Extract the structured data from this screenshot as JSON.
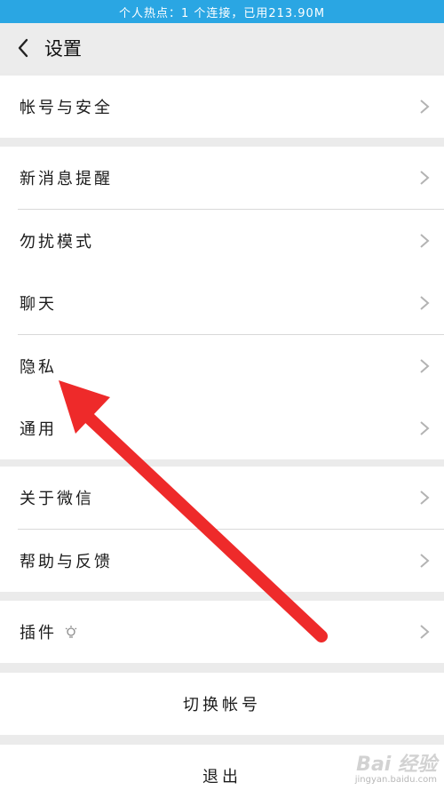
{
  "status_bar": {
    "text": "个人热点：1 个连接，已用213.90M"
  },
  "header": {
    "title": "设置",
    "back_icon": "chevron-left-icon"
  },
  "groups": [
    {
      "items": [
        {
          "label": "帐号与安全"
        }
      ]
    },
    {
      "items": [
        {
          "label": "新消息提醒"
        },
        {
          "label": "勿扰模式"
        },
        {
          "label": "聊天"
        },
        {
          "label": "隐私"
        },
        {
          "label": "通用"
        }
      ]
    },
    {
      "items": [
        {
          "label": "关于微信"
        },
        {
          "label": "帮助与反馈"
        }
      ]
    },
    {
      "items": [
        {
          "label": "插件",
          "icon": "bulb-icon"
        }
      ]
    }
  ],
  "actions": {
    "switch_account": "切换帐号",
    "logout": "退出"
  },
  "annotation": {
    "color": "#ee2a2a",
    "icon": "red-arrow"
  },
  "watermark": {
    "brand": "Bai 经验",
    "site": "jingyan.baidu.com"
  },
  "colors": {
    "status_bar": "#2aa6e3",
    "background": "#ebebeb",
    "chevron": "#b3b3b3"
  }
}
